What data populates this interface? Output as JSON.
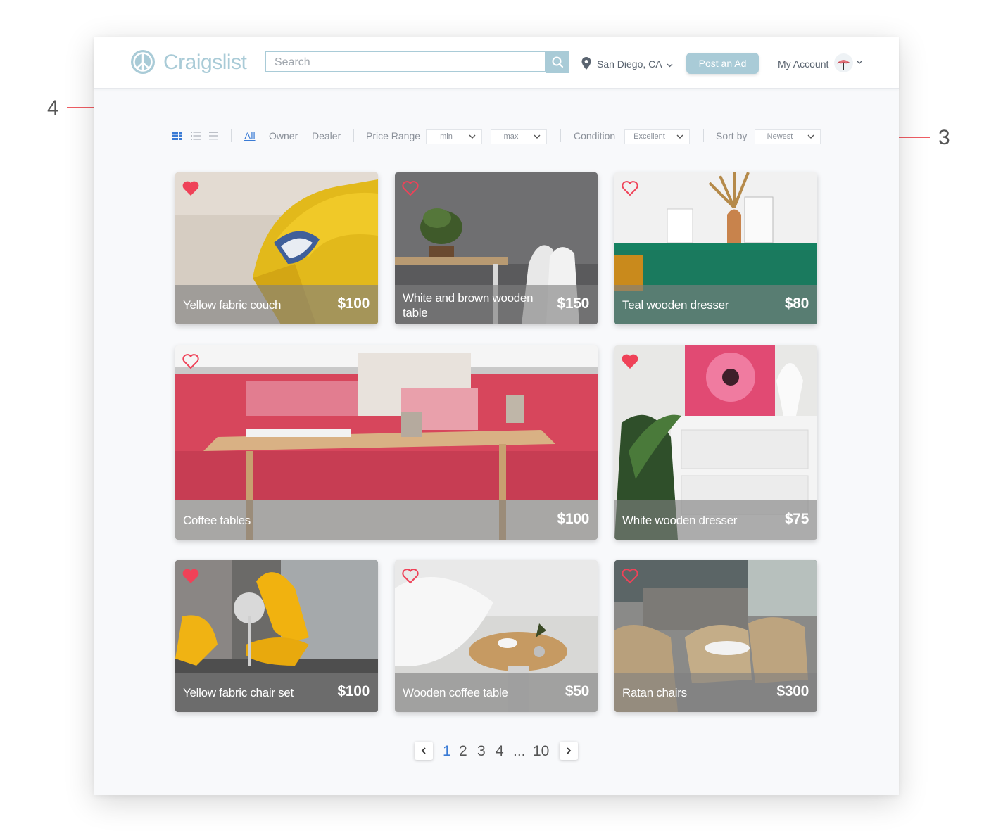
{
  "header": {
    "logo_text": "Craigslist",
    "search_placeholder": "Search",
    "location": "San Diego, CA",
    "post_button": "Post an Ad",
    "account_label": "My Account"
  },
  "filters": {
    "view_modes": [
      "grid-view-icon",
      "list-view-icon",
      "compact-view-icon"
    ],
    "seller_tabs": [
      "All",
      "Owner",
      "Dealer"
    ],
    "active_seller_tab": "All",
    "price_range_label": "Price Range",
    "price_min": "min",
    "price_max": "max",
    "condition_label": "Condition",
    "condition_value": "Excellent",
    "sort_label": "Sort by",
    "sort_value": "Newest"
  },
  "listings": [
    {
      "title": "Yellow fabric couch",
      "price": "$100",
      "favorited": true
    },
    {
      "title": "White and brown wooden table",
      "price": "$150",
      "favorited": false
    },
    {
      "title": "Teal wooden dresser",
      "price": "$80",
      "favorited": false
    },
    {
      "title": "Coffee tables",
      "price": "$100",
      "favorited": false
    },
    {
      "title": "White wooden dresser",
      "price": "$75",
      "favorited": true
    },
    {
      "title": "Yellow fabric chair set",
      "price": "$100",
      "favorited": true
    },
    {
      "title": "Wooden coffee table",
      "price": "$50",
      "favorited": false
    },
    {
      "title": "Ratan chairs",
      "price": "$300",
      "favorited": false
    }
  ],
  "pagination": {
    "pages": [
      "1",
      "2",
      "3",
      "4",
      "...",
      "10"
    ],
    "current": "1"
  },
  "annotations": {
    "callout_left": "4",
    "callout_right": "3"
  },
  "colors": {
    "brand": "#a9cbd7",
    "accent_link": "#3a7bd5",
    "heart": "#ef4258",
    "callout": "#ef5d64"
  }
}
